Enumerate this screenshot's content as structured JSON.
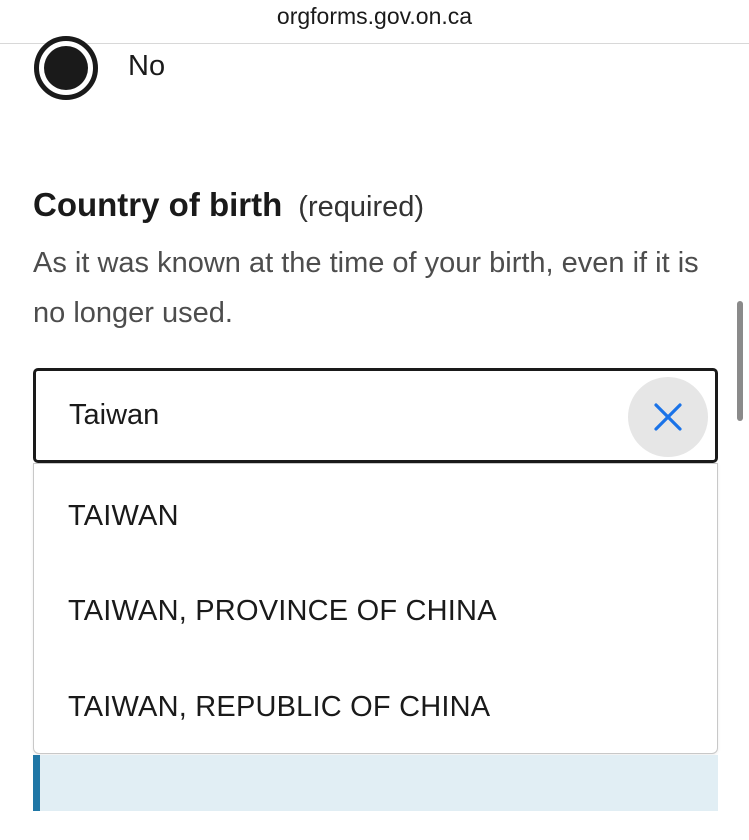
{
  "browser": {
    "url": "orgforms.gov.on.ca"
  },
  "radio": {
    "label": "No",
    "checked": true
  },
  "country_field": {
    "label": "Country of birth",
    "required_text": "(required)",
    "hint": "As it was known at the time of your birth, even if it is no longer used.",
    "value": "Taiwan",
    "clear_icon": "close-icon"
  },
  "suggestions": [
    "TAIWAN",
    "TAIWAN, PROVINCE OF CHINA",
    "TAIWAN, REPUBLIC OF CHINA"
  ],
  "colors": {
    "clear_icon": "#1a73e8",
    "callout_bg": "#e1eef4",
    "callout_accent": "#1f77a6"
  }
}
